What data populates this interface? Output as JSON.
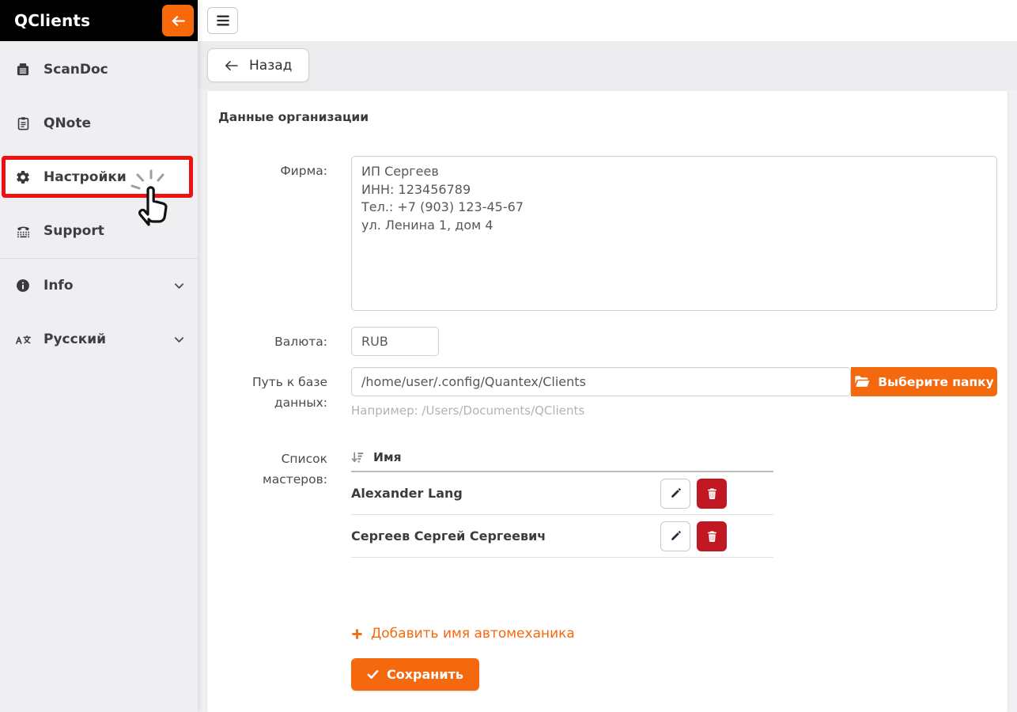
{
  "app": {
    "title": "QClients"
  },
  "sidebar": {
    "items": [
      {
        "label": "ScanDoc"
      },
      {
        "label": "QNote"
      },
      {
        "label": "Настройки"
      },
      {
        "label": "Support"
      },
      {
        "label": "Info"
      },
      {
        "label": "Русский"
      }
    ]
  },
  "toolbar": {
    "back_label": "Назад"
  },
  "form": {
    "section_title": "Данные организации",
    "company": {
      "label": "Фирма:",
      "value": "ИП Сергеев\nИНН: 123456789\nТел.: +7 (903) 123-45-67\nул. Ленина 1, дом 4"
    },
    "currency": {
      "label": "Валюта:",
      "value": "RUB"
    },
    "db_path": {
      "label": "Путь к базе данных:",
      "value": "/home/user/.config/Quantex/Clients",
      "button_label": "Выберите папку",
      "hint": "Например: /Users/Documents/QClients"
    },
    "masters": {
      "label": "Список мастеров:",
      "column_header": "Имя",
      "rows": [
        {
          "name": "Alexander Lang"
        },
        {
          "name": "Сергеев Сергей Сергеевич"
        }
      ],
      "add_label": "Добавить имя автомеханика"
    },
    "save_label": "Сохранить"
  },
  "colors": {
    "accent": "#f5690e",
    "danger": "#c01722",
    "highlight": "#ed1111"
  }
}
